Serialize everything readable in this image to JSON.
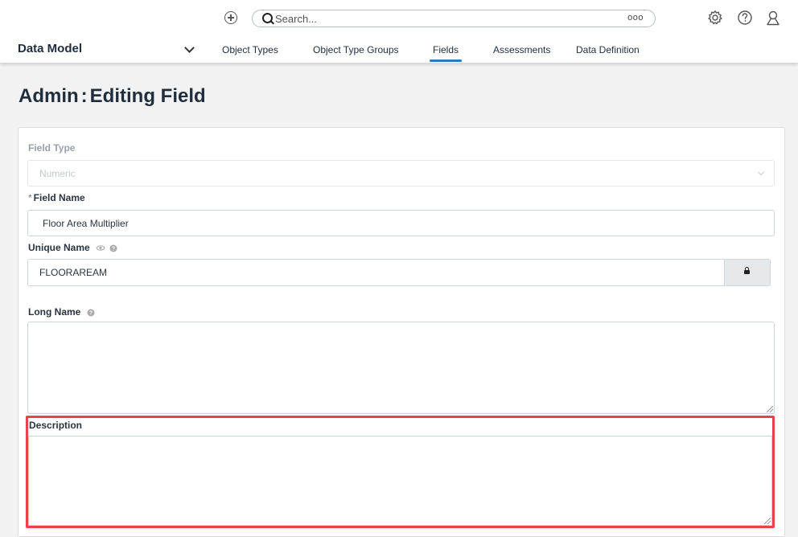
{
  "topbar": {
    "search_placeholder": "Search...",
    "more_label": "ooo",
    "icons": [
      "plus-circle-icon",
      "search-icon",
      "gear-icon",
      "help-icon",
      "user-icon"
    ]
  },
  "navbar": {
    "module": "Data Model",
    "tabs": [
      {
        "label": "Object Types",
        "active": false
      },
      {
        "label": "Object Type Groups",
        "active": false
      },
      {
        "label": "Fields",
        "active": true
      },
      {
        "label": "Assessments",
        "active": false
      },
      {
        "label": "Data Definition",
        "active": false
      }
    ]
  },
  "page": {
    "title_prefix": "Admin",
    "title_sep": ":",
    "title_main": "Editing Field"
  },
  "form": {
    "field_type": {
      "label": "Field Type",
      "value": "Numeric"
    },
    "field_name": {
      "required_mark": "*",
      "label": "Field Name",
      "value": "Floor Area Multiplier"
    },
    "unique_name": {
      "label": "Unique Name",
      "value": "FLOORAREAM"
    },
    "long_name": {
      "label": "Long Name",
      "value": ""
    },
    "description": {
      "label": "Description",
      "value": ""
    }
  },
  "colors": {
    "accent": "#2a78c2",
    "highlight": "#e8434b"
  }
}
